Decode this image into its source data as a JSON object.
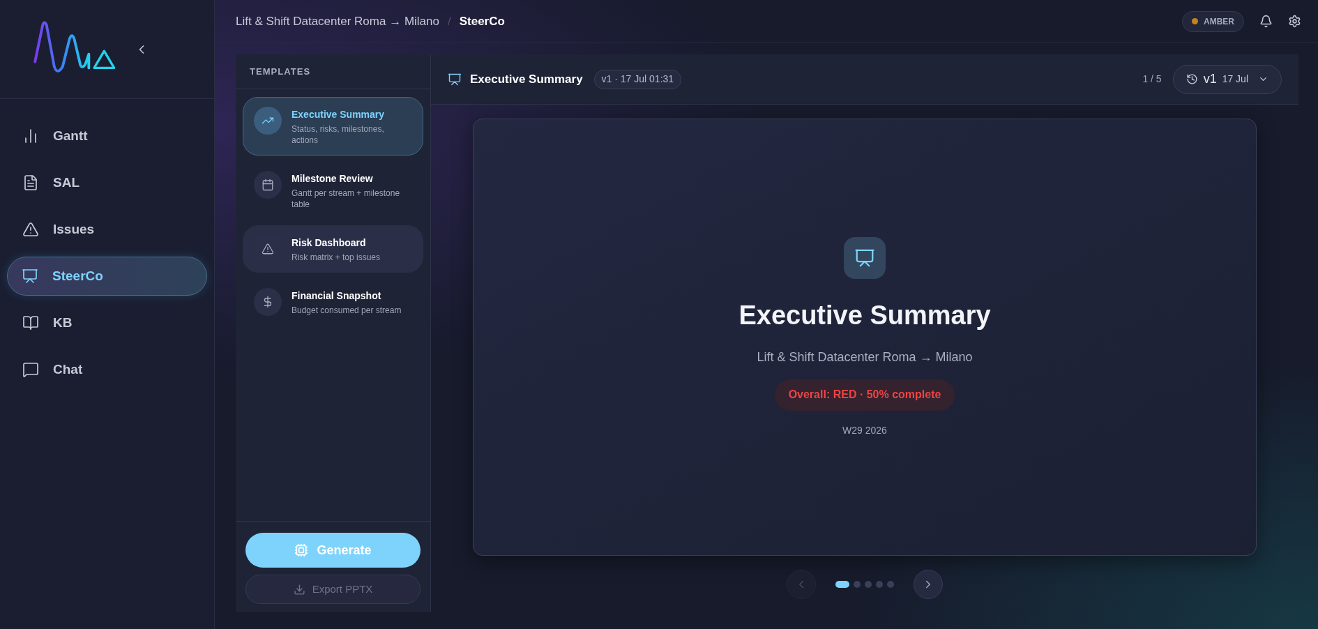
{
  "sidebar": {
    "items": [
      {
        "label": "Gantt",
        "selected": false
      },
      {
        "label": "SAL",
        "selected": false
      },
      {
        "label": "Issues",
        "selected": false
      },
      {
        "label": "SteerCo",
        "selected": true
      },
      {
        "label": "KB",
        "selected": false
      },
      {
        "label": "Chat",
        "selected": false
      }
    ]
  },
  "breadcrumb": {
    "project": "Lift & Shift Datacenter Roma → Milano",
    "separator": "/",
    "current": "SteerCo"
  },
  "status_badge": {
    "label": "AMBER"
  },
  "templates": {
    "title": "TEMPLATES",
    "items": [
      {
        "title": "Executive Summary",
        "description": "Status, risks, milestones, actions",
        "selected": true,
        "hovered": false
      },
      {
        "title": "Milestone Review",
        "description": "Gantt per stream + milestone table",
        "selected": false,
        "hovered": false
      },
      {
        "title": "Risk Dashboard",
        "description": "Risk matrix + top issues",
        "selected": false,
        "hovered": true
      },
      {
        "title": "Financial Snapshot",
        "description": "Budget consumed per stream",
        "selected": false,
        "hovered": false
      }
    ]
  },
  "actions": {
    "generate": {
      "label": "Generate",
      "disabled": false
    },
    "export": {
      "label": "Export PPTX",
      "disabled": true
    }
  },
  "preview": {
    "title": "Executive Summary",
    "version_badge": "v1 · 17 Jul 01:31",
    "page": "1 / 5",
    "version_select": {
      "version": "v1",
      "date": "17 Jul"
    }
  },
  "slide": {
    "title": "Executive Summary",
    "subtitle": "Lift & Shift Datacenter Roma → Milano",
    "status": "Overall: RED · 50% complete",
    "week": "W29 2026"
  },
  "carousel": {
    "prev_disabled": true,
    "next_disabled": false,
    "dots": [
      {
        "selected": true
      },
      {
        "selected": false
      },
      {
        "selected": false
      },
      {
        "selected": false
      },
      {
        "selected": false
      }
    ]
  }
}
